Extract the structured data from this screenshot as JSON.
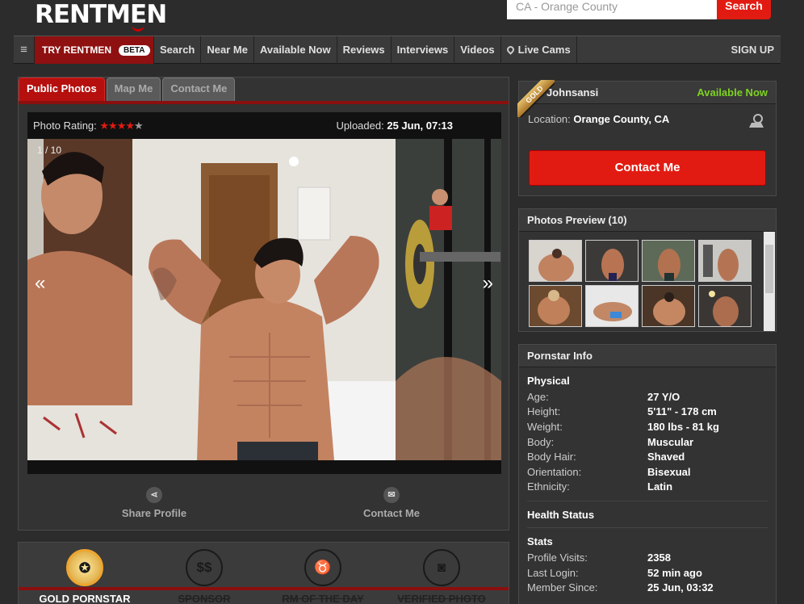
{
  "header": {
    "logo_left": "RENTM",
    "logo_o": "E",
    "logo_right": "N",
    "search_placeholder": "CA - Orange County",
    "search_button": "Search"
  },
  "nav": {
    "menu_icon": "≡",
    "try": "TRY RENTMEN",
    "beta": "BETA",
    "items": [
      "Search",
      "Near Me",
      "Available Now",
      "Reviews",
      "Interviews",
      "Videos",
      "Live Cams"
    ],
    "signup": "SIGN UP"
  },
  "tabs": [
    "Public Photos",
    "Map Me",
    "Contact Me"
  ],
  "photo": {
    "rating_label": "Photo Rating:",
    "stars_on": "★★★★",
    "stars_off": "★",
    "rating": 4,
    "rating_max": 5,
    "uploaded_label": "Uploaded:",
    "uploaded": "25 Jun, 07:13",
    "counter": "1 / 10",
    "prev": "«",
    "next": "»"
  },
  "actions": {
    "share": "Share Profile",
    "contact": "Contact Me"
  },
  "badges": {
    "gold": "GOLD PORNSTAR",
    "sponsor": "SPONSOR",
    "rm": "RM OF THE DAY",
    "verified": "VERIFIED PHOTO",
    "sponsor_icon": "$$",
    "rm_icon": "♉",
    "verified_icon": "◙"
  },
  "profile": {
    "ribbon": "GOLD",
    "name": "Johnsansi",
    "status": "Available Now",
    "location_label": "Location:",
    "location": "Orange County, CA",
    "contact_button": "Contact Me"
  },
  "photos_preview": {
    "title": "Photos Preview (10)"
  },
  "info": {
    "title": "Pornstar Info",
    "physical_title": "Physical",
    "physical": [
      [
        "Age:",
        "27 Y/O"
      ],
      [
        "Height:",
        "5'11\" - 178 cm"
      ],
      [
        "Weight:",
        "180 lbs - 81 kg"
      ],
      [
        "Body:",
        "Muscular"
      ],
      [
        "Body Hair:",
        "Shaved"
      ],
      [
        "Orientation:",
        "Bisexual"
      ],
      [
        "Ethnicity:",
        "Latin"
      ]
    ],
    "health_title": "Health Status",
    "stats_title": "Stats",
    "stats": [
      [
        "Profile Visits:",
        "2358"
      ],
      [
        "Last Login:",
        "52 min ago"
      ],
      [
        "Member Since:",
        "25 Jun, 03:32"
      ]
    ]
  },
  "colors": {
    "accent": "#e21b12",
    "available": "#7ed321"
  }
}
